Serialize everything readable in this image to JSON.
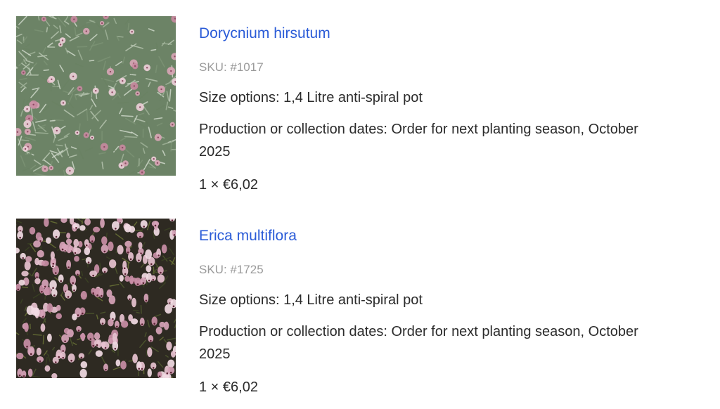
{
  "items": [
    {
      "name": "Dorycnium hirsutum",
      "sku": "SKU: #1017",
      "size": "Size options: 1,4 Litre anti-spiral pot",
      "dates": "Production or collection dates: Order for next planting season, October 2025",
      "price": "1 × €6,02"
    },
    {
      "name": "Erica multiflora",
      "sku": "SKU: #1725",
      "size": "Size options: 1,4 Litre anti-spiral pot",
      "dates": "Production or collection dates: Order for next planting season, October 2025",
      "price": "1 × €6,02"
    }
  ],
  "colors": {
    "link": "#2a5bd7",
    "sku": "#9a9a9a",
    "text": "#2b2b2b"
  }
}
